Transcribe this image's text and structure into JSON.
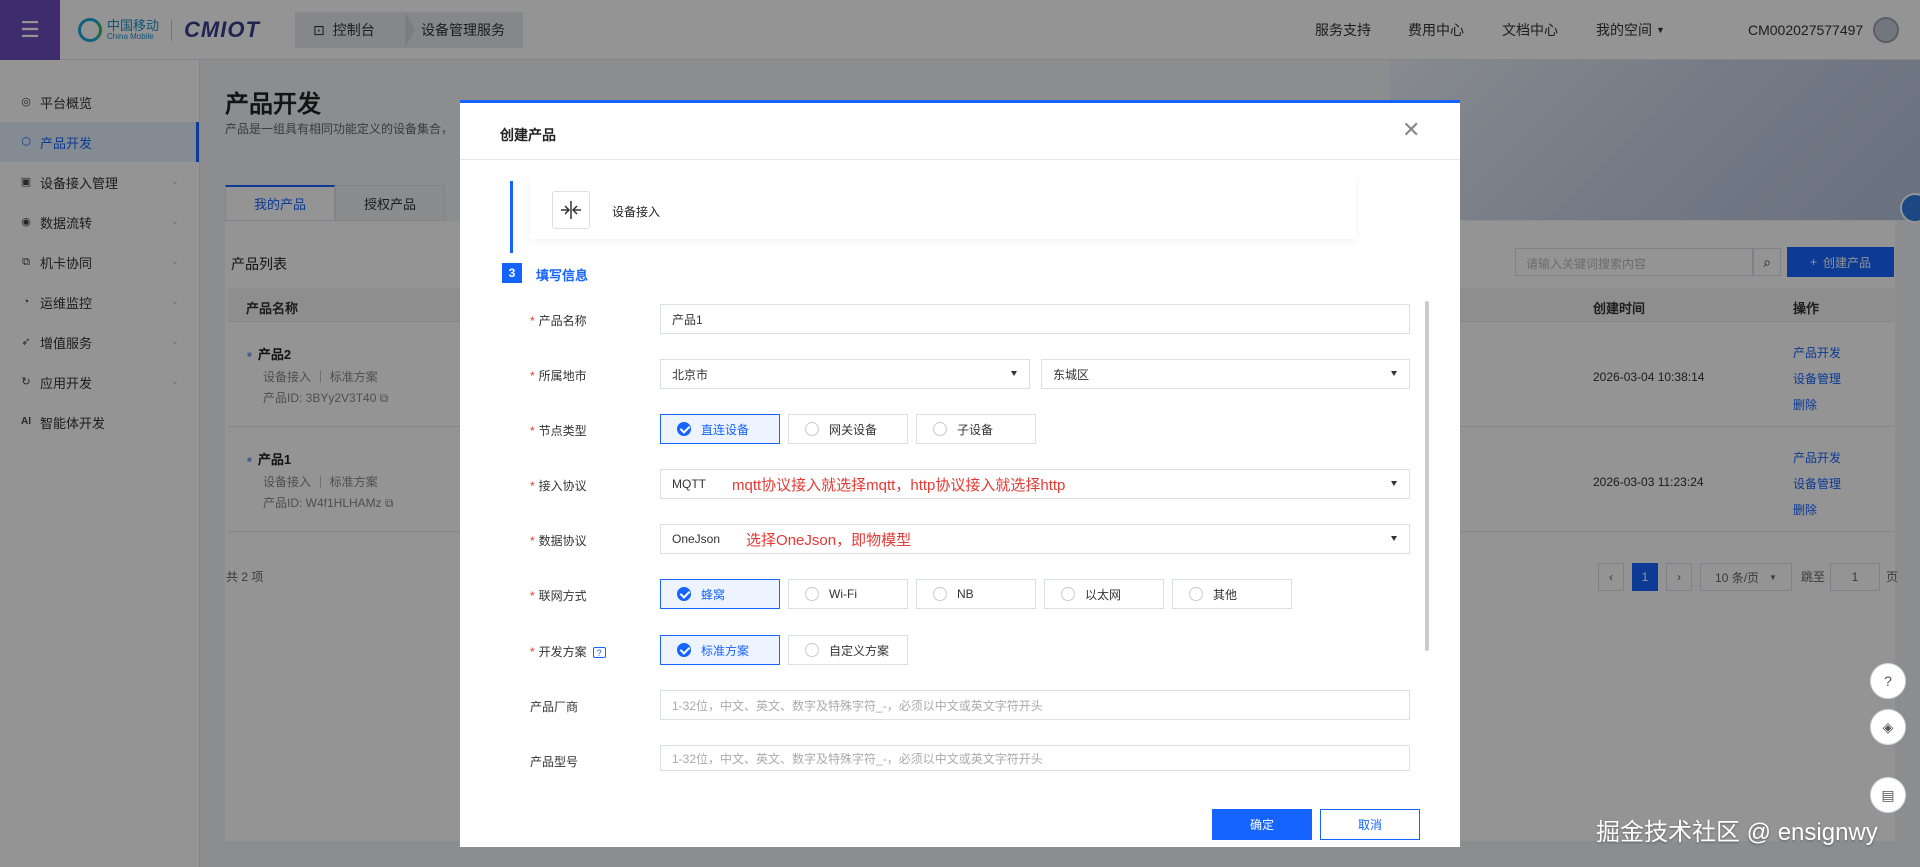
{
  "header": {
    "logo_cn": "中国移动",
    "logo_en": "China Mobile",
    "logo_product": "CMIOT",
    "crumbs": [
      "控制台",
      "设备管理服务"
    ],
    "nav": [
      "服务支持",
      "费用中心",
      "文档中心",
      "我的空间"
    ],
    "account": "CM002027577497"
  },
  "sidebar": {
    "items": [
      {
        "label": "平台概览",
        "icon": "dashboard-icon"
      },
      {
        "label": "产品开发",
        "icon": "cube-icon"
      },
      {
        "label": "设备接入管理",
        "icon": "device-icon"
      },
      {
        "label": "数据流转",
        "icon": "flow-icon"
      },
      {
        "label": "机卡协同",
        "icon": "card-icon"
      },
      {
        "label": "运维监控",
        "icon": "monitor-icon"
      },
      {
        "label": "增值服务",
        "icon": "rocket-icon"
      },
      {
        "label": "应用开发",
        "icon": "app-icon"
      },
      {
        "label": "智能体开发",
        "icon": "ai-icon"
      }
    ],
    "ai_glyph": "AI"
  },
  "page": {
    "title": "产品开发",
    "desc": "产品是一组具有相同功能定义的设备集合，",
    "tabs": [
      "我的产品",
      "授权产品"
    ],
    "list_title": "产品列表",
    "search_placeholder": "请输入关键词搜索内容",
    "create_label": "创建产品",
    "columns": [
      "产品名称",
      "创建时间",
      "操作"
    ],
    "products": [
      {
        "name": "产品2",
        "meta": "设备接入 ｜ 标准方案",
        "id": "产品ID:  3BYy2V3T40",
        "time": "2026-03-04 10:38:14",
        "actions": [
          "产品开发",
          "设备管理",
          "删除"
        ]
      },
      {
        "name": "产品1",
        "meta": "设备接入 ｜ 标准方案",
        "id": "产品ID:  W4f1HLHAMz",
        "time": "2026-03-03 11:23:24",
        "actions": [
          "产品开发",
          "设备管理",
          "删除"
        ]
      }
    ],
    "total": "共 2 项",
    "pager": {
      "current": "1",
      "size": "10 条/页",
      "jump": "跳至",
      "jump_val": "1",
      "page_suffix": "页"
    }
  },
  "modal": {
    "title": "创建产品",
    "access_type": "设备接入",
    "step_num": "3",
    "step_label": "填写信息",
    "fields": {
      "product_name": {
        "label": "产品名称",
        "value": "产品1"
      },
      "city": {
        "label": "所属地市",
        "province": "北京市",
        "district": "东城区"
      },
      "node_type": {
        "label": "节点类型",
        "options": [
          "直连设备",
          "网关设备",
          "子设备"
        ],
        "selected": 0
      },
      "protocol": {
        "label": "接入协议",
        "value": "MQTT",
        "note": "mqtt协议接入就选择mqtt，http协议接入就选择http"
      },
      "data_protocol": {
        "label": "数据协议",
        "value": "OneJson",
        "note": "选择OneJson，即物模型"
      },
      "network": {
        "label": "联网方式",
        "options": [
          "蜂窝",
          "Wi-Fi",
          "NB",
          "以太网",
          "其他"
        ],
        "selected": 0
      },
      "dev_plan": {
        "label": "开发方案",
        "options": [
          "标准方案",
          "自定义方案"
        ],
        "selected": 0
      },
      "vendor": {
        "label": "产品厂商",
        "placeholder": "1-32位，中文、英文、数字及特殊字符_-，必须以中文或英文字符开头"
      },
      "model": {
        "label": "产品型号",
        "placeholder": "1-32位，中文、英文、数字及特殊字符_-，必须以中文或英文字符开头"
      }
    },
    "ok": "确定",
    "cancel": "取消"
  },
  "watermark": "掘金技术社区 @ ensignwy",
  "colors": {
    "accent": "#1664ff",
    "note": "#e53935",
    "brand_purple": "#6b4fbb"
  }
}
